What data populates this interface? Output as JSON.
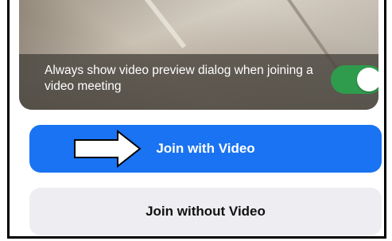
{
  "preview": {
    "setting_text": "Always show video preview dialog when joining a video meeting",
    "toggle_state": "on"
  },
  "buttons": {
    "join_with_video": "Join with Video",
    "join_without_video": "Join without Video"
  },
  "colors": {
    "primary_button": "#1a73f2",
    "secondary_button": "#eeedf2",
    "toggle_on": "#2f9b4d"
  },
  "annotation": {
    "icon": "arrow-right-icon"
  }
}
